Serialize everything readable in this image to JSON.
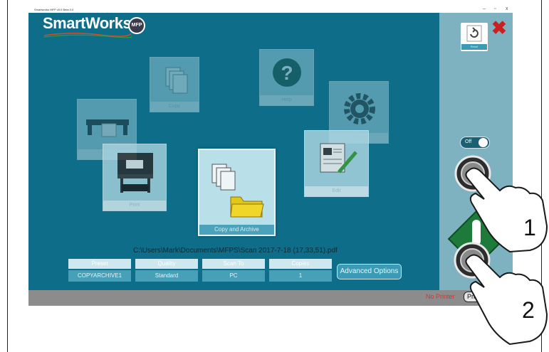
{
  "window": {
    "title": "Smartworks MFP v5.0 Beta 0.0",
    "minimize": "–",
    "maximize": "▫",
    "close": "x"
  },
  "app": {
    "logo_text": "SmartWorks",
    "logo_badge": "MFP"
  },
  "tiles": {
    "copy": "Copy",
    "help": "Help",
    "settings": "Settings",
    "scan": "Scan",
    "print": "Print",
    "copy_and_archive": "Copy and Archive",
    "edit": "Edit"
  },
  "file_path": "C:\\Users\\Mark\\Documents\\MFPS\\Scan 2017-7-18 (17,33,51).pdf",
  "fields": [
    {
      "label": "Preset",
      "value": "COPYARCHIVE1"
    },
    {
      "label": "Quality",
      "value": "Standard"
    },
    {
      "label": "Scan To",
      "value": "PC"
    },
    {
      "label": "Copies",
      "value": "1"
    }
  ],
  "advanced_options": "Advanced Options",
  "status": {
    "no_printer": "No Printer",
    "printer_button": "Printer"
  },
  "sidebar": {
    "reset_label": "Reset",
    "toggle_text": "Off"
  },
  "callouts": {
    "one": "1",
    "two": "2"
  },
  "colors": {
    "app_background": "#0e6d88",
    "sidebar": "#7fb2c1",
    "start_button": "#1d7a3a",
    "close_x": "#cc2020",
    "no_printer": "#e23030"
  }
}
